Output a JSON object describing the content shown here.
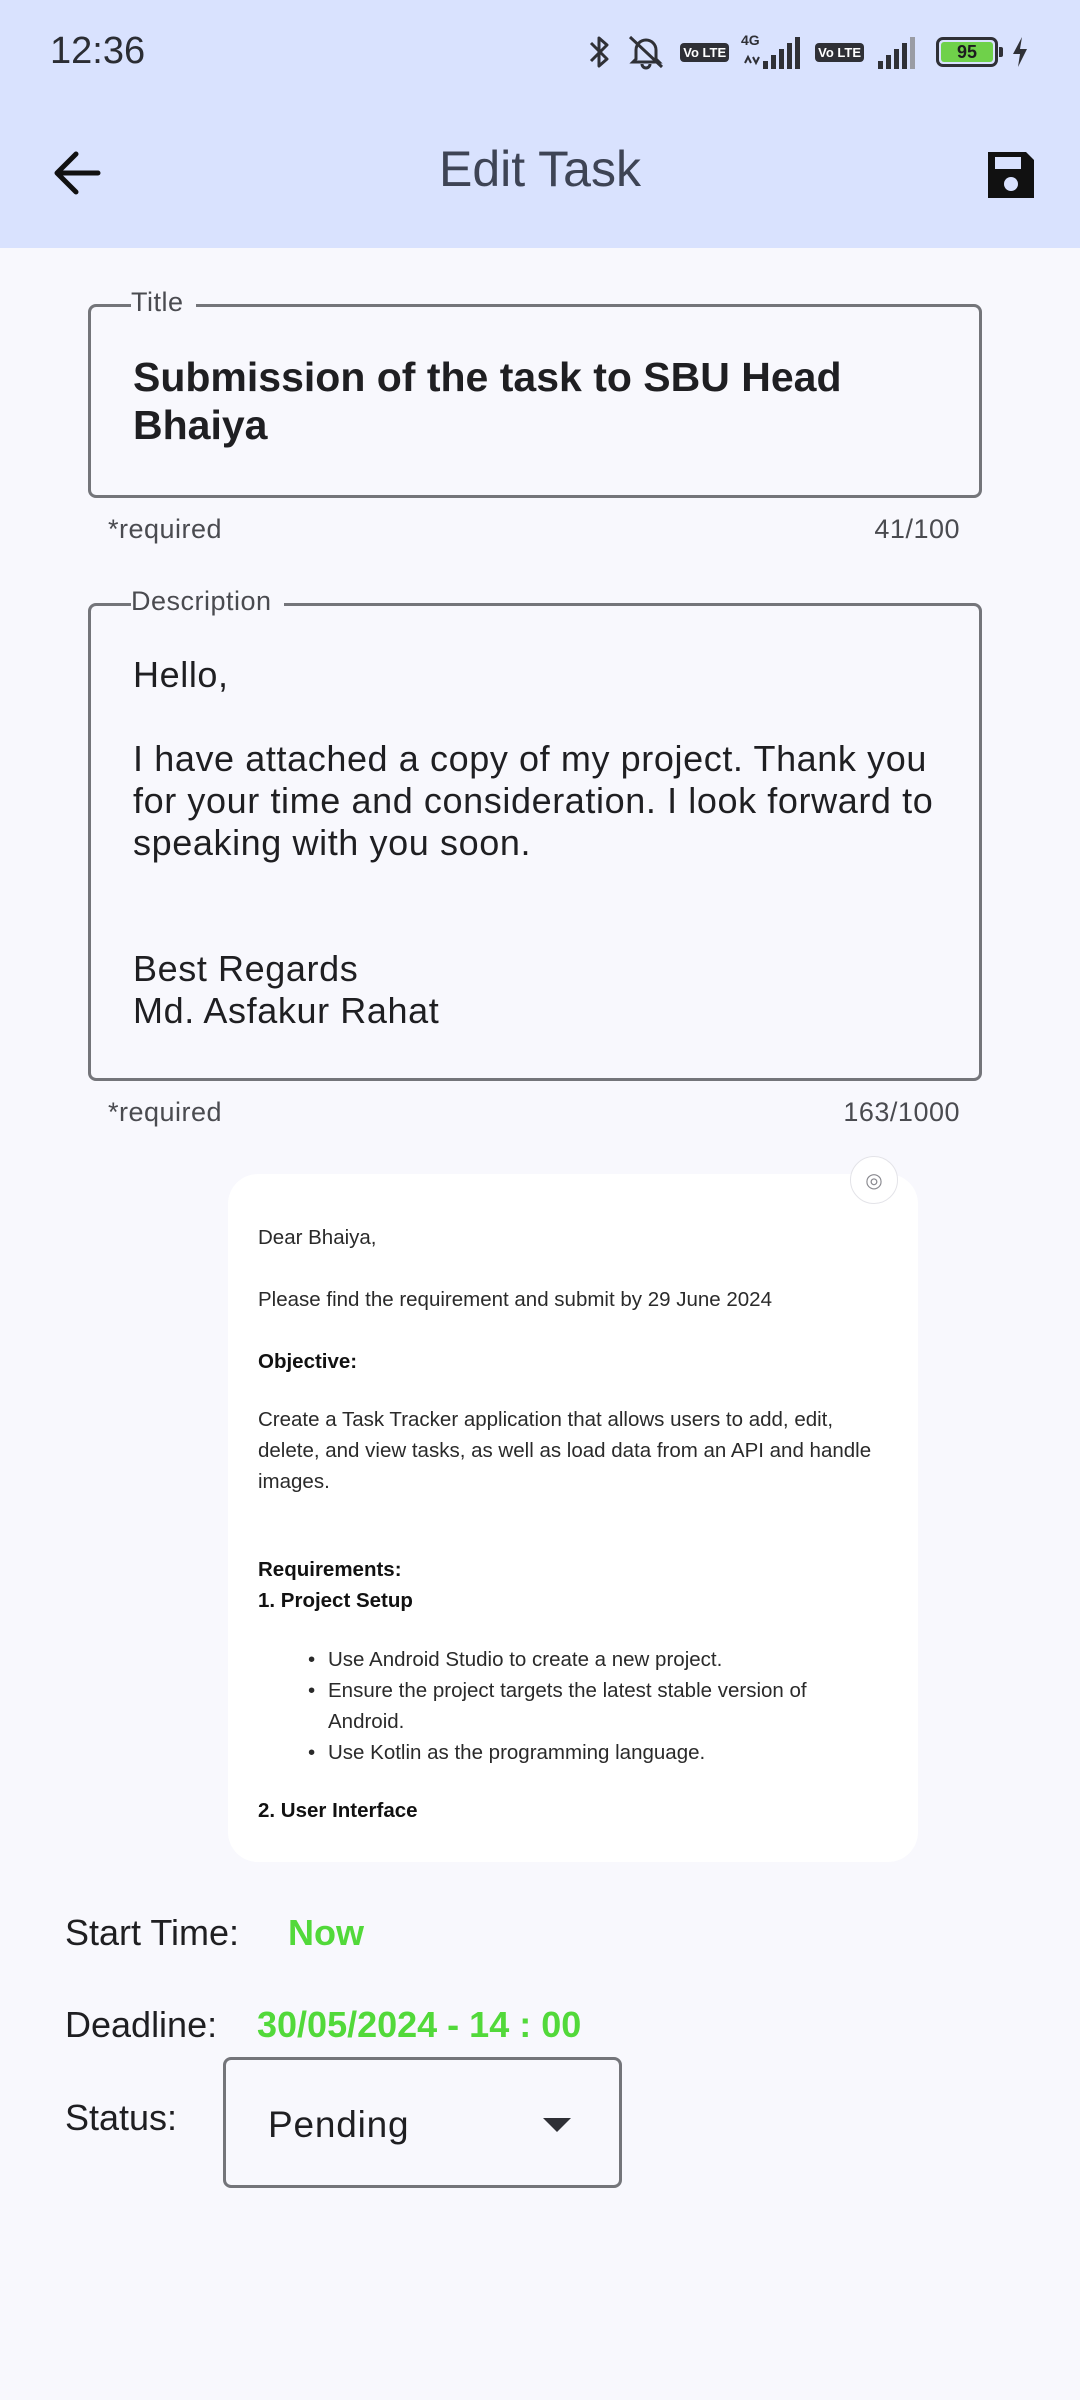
{
  "status_bar": {
    "time": "12:36",
    "network": "4G",
    "lte_badge": "Vo LTE",
    "battery_level": "95",
    "icons": [
      "bluetooth-icon",
      "mute-icon",
      "volte-icon",
      "signal-icon",
      "battery-icon",
      "charging-icon"
    ]
  },
  "app_bar": {
    "title": "Edit Task",
    "back_icon": "arrow-back-icon",
    "save_icon": "save-icon"
  },
  "title_field": {
    "label": "Title",
    "value": "Submission of the task to SBU Head Bhaiya",
    "helper": "*required",
    "counter": "41/100"
  },
  "description_field": {
    "label": "Description",
    "value": "Hello,\n\nI have attached a copy of my project. Thank you for your time and consideration. I look forward to speaking with you soon.\n\n\nBest Regards\nMd. Asfakur Rahat",
    "helper": "*required",
    "counter": "163/1000"
  },
  "attachment": {
    "greeting": "Dear Bhaiya,",
    "instruction": "Please find the requirement and submit by 29 June 2024",
    "objective_heading": "Objective:",
    "objective_text": "Create a Task Tracker application that allows users to add, edit, delete, and view tasks, as well as load data from an API and handle images.",
    "requirements_heading": "Requirements:",
    "section1_heading": "1. Project Setup",
    "section1_items": [
      "Use Android Studio to create a new project.",
      "Ensure the project targets the latest stable version of Android.",
      "Use Kotlin as the programming language."
    ],
    "section2_heading": "2. User Interface"
  },
  "schedule": {
    "start_label": "Start Time:",
    "start_value": "Now",
    "deadline_label": "Deadline:",
    "deadline_value": "30/05/2024 - 14 : 00",
    "status_label": "Status:",
    "status_value": "Pending"
  },
  "colors": {
    "app_bar_bg": "#d9e2fe",
    "page_bg": "#f8f8fd",
    "accent_green": "#52d93a",
    "outline": "#74757a"
  }
}
